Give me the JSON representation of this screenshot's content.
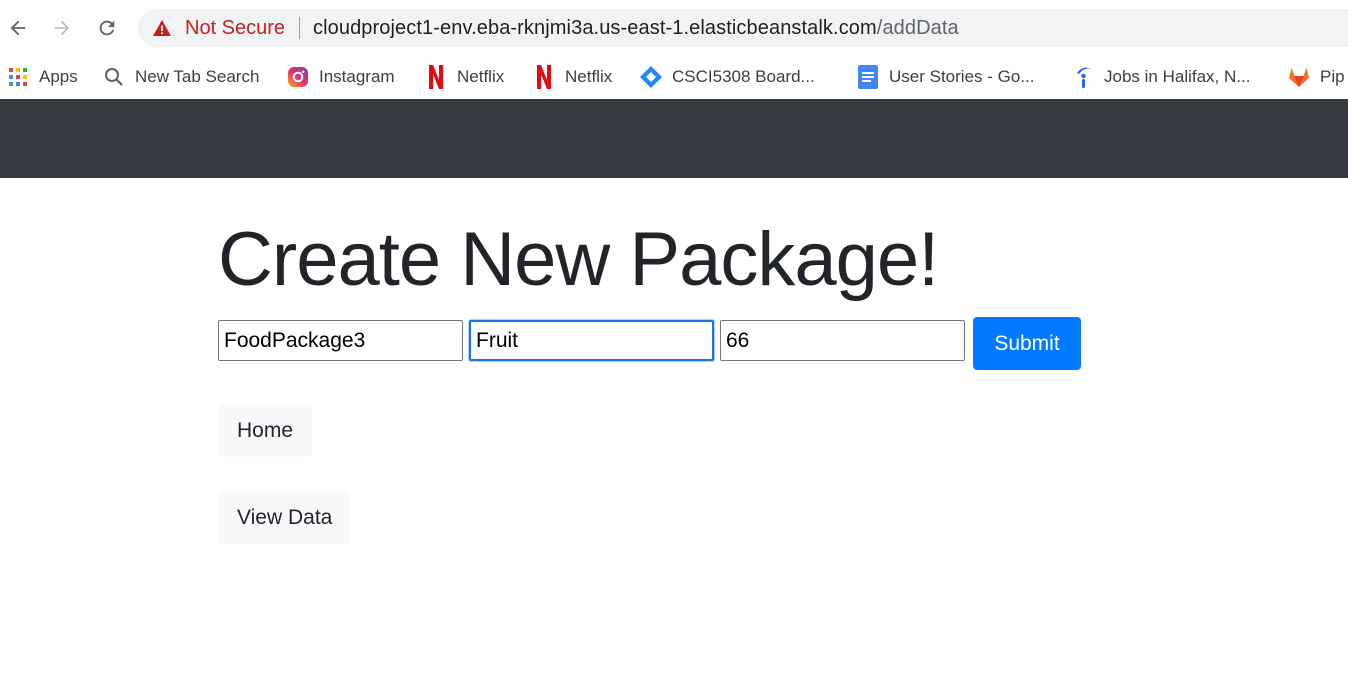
{
  "browser": {
    "security_label": "Not Secure",
    "url_host": "cloudproject1-env.eba-rknjmi3a.us-east-1.elasticbeanstalk.com",
    "url_path": "/addData",
    "warning_color": "#c5221f"
  },
  "bookmarks": [
    {
      "label": "Apps",
      "icon": "apps-grid-icon"
    },
    {
      "label": "New Tab Search",
      "icon": "search-icon"
    },
    {
      "label": "Instagram",
      "icon": "instagram-icon"
    },
    {
      "label": "Netflix",
      "icon": "netflix-icon"
    },
    {
      "label": "Netflix",
      "icon": "netflix-icon"
    },
    {
      "label": "CSCI5308 Board...",
      "icon": "jira-icon"
    },
    {
      "label": "User Stories - Go...",
      "icon": "google-docs-icon"
    },
    {
      "label": "Jobs in Halifax, N...",
      "icon": "indeed-icon"
    },
    {
      "label": "Pip",
      "icon": "gitlab-icon"
    }
  ],
  "navbar": {
    "color": "#343a40"
  },
  "page": {
    "title": "Create New Package!",
    "form": {
      "name_value": "FoodPackage3",
      "type_value": "Fruit",
      "quantity_value": "66",
      "submit_label": "Submit",
      "submit_color": "#007bff"
    },
    "home_label": "Home",
    "view_data_label": "View Data"
  }
}
